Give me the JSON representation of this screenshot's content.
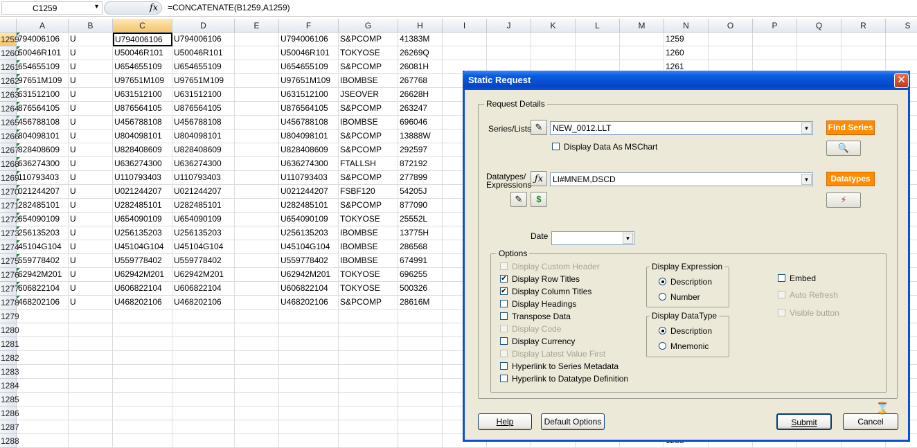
{
  "formula_bar": {
    "name_box": "C1259",
    "fx": "fx",
    "formula": "=CONCATENATE(B1259,A1259)"
  },
  "columns": [
    "A",
    "B",
    "C",
    "D",
    "E",
    "F",
    "G",
    "H",
    "I",
    "J",
    "K",
    "L",
    "M",
    "N",
    "O",
    "P",
    "Q",
    "R",
    "S"
  ],
  "rows": [
    {
      "n": "1259",
      "a": "794006106",
      "b": "U",
      "c": "U794006106",
      "d": "U794006106",
      "f": "U794006106",
      "g": "S&PCOMP",
      "h": "41383M"
    },
    {
      "n": "1260",
      "a": "50046R101",
      "b": "U",
      "c": "U50046R101",
      "d": "U50046R101",
      "f": "U50046R101",
      "g": "TOKYOSE",
      "h": "26269Q"
    },
    {
      "n": "1261",
      "a": "654655109",
      "b": "U",
      "c": "U654655109",
      "d": "U654655109",
      "f": "U654655109",
      "g": "S&PCOMP",
      "h": "26081H"
    },
    {
      "n": "1262",
      "a": "97651M109",
      "b": "U",
      "c": "U97651M109",
      "d": "U97651M109",
      "f": "U97651M109",
      "g": "IBOMBSE",
      "h": "267768"
    },
    {
      "n": "1263",
      "a": "631512100",
      "b": "U",
      "c": "U631512100",
      "d": "U631512100",
      "f": "U631512100",
      "g": "JSEOVER",
      "h": "26628H"
    },
    {
      "n": "1264",
      "a": "876564105",
      "b": "U",
      "c": "U876564105",
      "d": "U876564105",
      "f": "U876564105",
      "g": "S&PCOMP",
      "h": "263247"
    },
    {
      "n": "1265",
      "a": "456788108",
      "b": "U",
      "c": "U456788108",
      "d": "U456788108",
      "f": "U456788108",
      "g": "IBOMBSE",
      "h": "696046"
    },
    {
      "n": "1266",
      "a": "804098101",
      "b": "U",
      "c": "U804098101",
      "d": "U804098101",
      "f": "U804098101",
      "g": "S&PCOMP",
      "h": "13888W"
    },
    {
      "n": "1267",
      "a": "828408609",
      "b": "U",
      "c": "U828408609",
      "d": "U828408609",
      "f": "U828408609",
      "g": "S&PCOMP",
      "h": "292597"
    },
    {
      "n": "1268",
      "a": "636274300",
      "b": "U",
      "c": "U636274300",
      "d": "U636274300",
      "f": "U636274300",
      "g": "FTALLSH",
      "h": "872192"
    },
    {
      "n": "1269",
      "a": "110793403",
      "b": "U",
      "c": "U110793403",
      "d": "U110793403",
      "f": "U110793403",
      "g": "S&PCOMP",
      "h": "277899"
    },
    {
      "n": "1270",
      "a": "021244207",
      "b": "U",
      "c": "U021244207",
      "d": "U021244207",
      "f": "U021244207",
      "g": "FSBF120",
      "h": "54205J"
    },
    {
      "n": "1271",
      "a": "282485101",
      "b": "U",
      "c": "U282485101",
      "d": "U282485101",
      "f": "U282485101",
      "g": "S&PCOMP",
      "h": "877090"
    },
    {
      "n": "1272",
      "a": "654090109",
      "b": "U",
      "c": "U654090109",
      "d": "U654090109",
      "f": "U654090109",
      "g": "TOKYOSE",
      "h": "25552L"
    },
    {
      "n": "1273",
      "a": "256135203",
      "b": "U",
      "c": "U256135203",
      "d": "U256135203",
      "f": "U256135203",
      "g": "IBOMBSE",
      "h": "13775H"
    },
    {
      "n": "1274",
      "a": "45104G104",
      "b": "U",
      "c": "U45104G104",
      "d": "U45104G104",
      "f": "U45104G104",
      "g": "IBOMBSE",
      "h": "286568"
    },
    {
      "n": "1275",
      "a": "559778402",
      "b": "U",
      "c": "U559778402",
      "d": "U559778402",
      "f": "U559778402",
      "g": "IBOMBSE",
      "h": "674991"
    },
    {
      "n": "1276",
      "a": "62942M201",
      "b": "U",
      "c": "U62942M201",
      "d": "U62942M201",
      "f": "U62942M201",
      "g": "TOKYOSE",
      "h": "696255"
    },
    {
      "n": "1277",
      "a": "606822104",
      "b": "U",
      "c": "U606822104",
      "d": "U606822104",
      "f": "U606822104",
      "g": "TOKYOSE",
      "h": "500326"
    },
    {
      "n": "1278",
      "a": "468202106",
      "b": "U",
      "c": "U468202106",
      "d": "U468202106",
      "f": "U468202106",
      "g": "S&PCOMP",
      "h": "28616M"
    },
    {
      "n": "1279"
    },
    {
      "n": "1280"
    },
    {
      "n": "1281"
    },
    {
      "n": "1282"
    },
    {
      "n": "1283"
    },
    {
      "n": "1284"
    },
    {
      "n": "1285"
    },
    {
      "n": "1286"
    },
    {
      "n": "1287"
    },
    {
      "n": "1288"
    }
  ],
  "dialog": {
    "title": "Static Request",
    "close": "✕",
    "request_details": "Request Details",
    "series_label": "Series/Lists",
    "series_value": "NEW_0012.LLT",
    "find_series": "Find Series",
    "display_chart": "Display Data As MSChart",
    "datatypes_label_1": "Datatypes/",
    "datatypes_label_2": "Expressions",
    "datatypes_value": "LI#MNEM,DSCD",
    "datatypes_btn": "Datatypes",
    "date_label": "Date",
    "date_value": "",
    "options_label": "Options",
    "options": [
      {
        "label": "Display Custom Header",
        "checked": false,
        "disabled": true
      },
      {
        "label": "Display Row Titles",
        "checked": true,
        "disabled": false
      },
      {
        "label": "Display Column Titles",
        "checked": true,
        "disabled": false
      },
      {
        "label": "Display Headings",
        "checked": false,
        "disabled": false
      },
      {
        "label": "Transpose Data",
        "checked": false,
        "disabled": false
      },
      {
        "label": "Display Code",
        "checked": false,
        "disabled": true
      },
      {
        "label": "Display Currency",
        "checked": false,
        "disabled": false
      },
      {
        "label": "Display Latest Value First",
        "checked": false,
        "disabled": true
      },
      {
        "label": "Hyperlink to Series Metadata",
        "checked": false,
        "disabled": false
      },
      {
        "label": "Hyperlink to Datatype Definition",
        "checked": false,
        "disabled": false
      }
    ],
    "display_expression": "Display Expression",
    "expr_description": "Description",
    "expr_number": "Number",
    "display_datatype": "Display DataType",
    "dt_description": "Description",
    "dt_mnemonic": "Mnemonic",
    "embed": "Embed",
    "auto_refresh": "Auto Refresh",
    "visible_button": "Visible button",
    "help": "Help",
    "default_options": "Default Options",
    "submit": "Submit",
    "cancel": "Cancel"
  }
}
